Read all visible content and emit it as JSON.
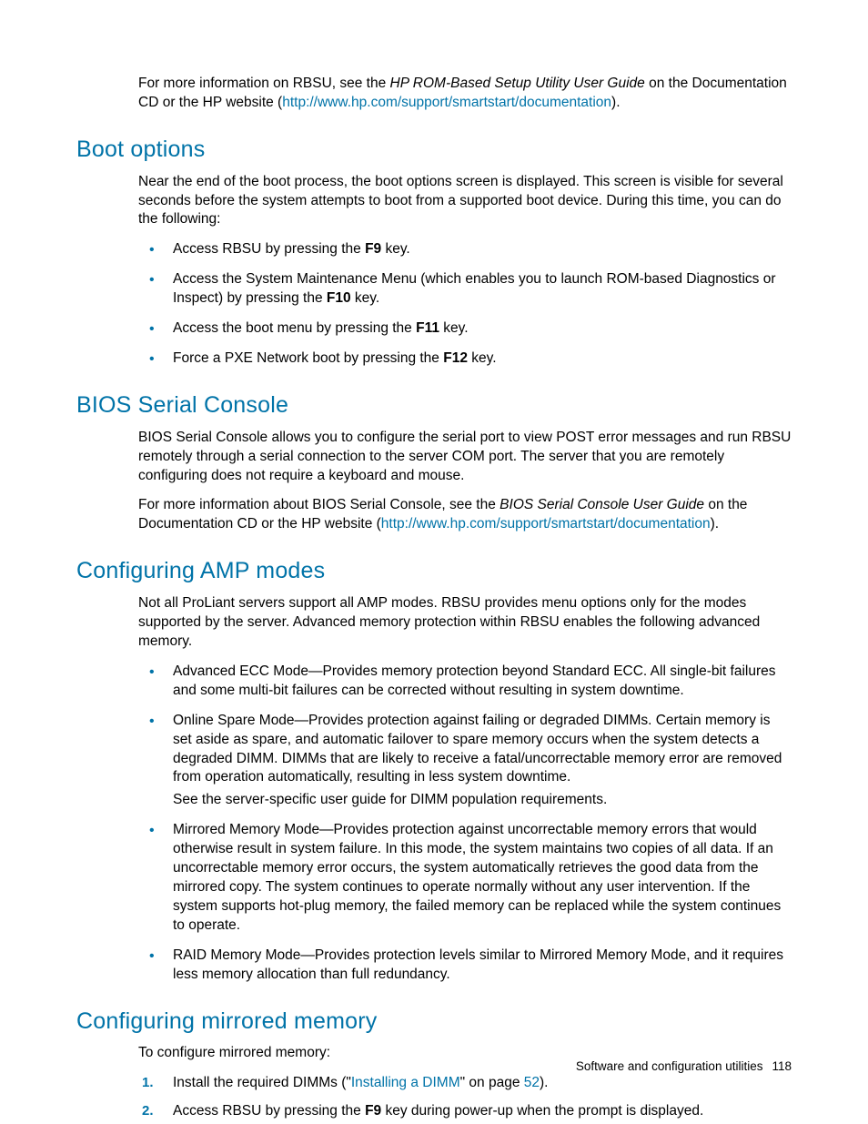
{
  "intro": {
    "pre": "For more information on RBSU, see the ",
    "em": "HP ROM-Based Setup Utility User Guide",
    "mid": " on the Documentation CD or the HP website (",
    "link": "http://www.hp.com/support/smartstart/documentation",
    "post": ")."
  },
  "boot": {
    "heading": "Boot options",
    "para": "Near the end of the boot process, the boot options screen is displayed. This screen is visible for several seconds before the system attempts to boot from a supported boot device. During this time, you can do the following:",
    "items": {
      "i1": {
        "pre": "Access RBSU by pressing the ",
        "key": "F9",
        "post": " key."
      },
      "i2": {
        "pre": "Access the System Maintenance Menu (which enables you to launch ROM-based Diagnostics or Inspect) by pressing the ",
        "key": "F10",
        "post": " key."
      },
      "i3": {
        "pre": "Access the boot menu by pressing the ",
        "key": "F11",
        "post": " key."
      },
      "i4": {
        "pre": "Force a PXE Network boot by pressing the ",
        "key": "F12",
        "post": " key."
      }
    }
  },
  "bios": {
    "heading": "BIOS Serial Console",
    "para1": "BIOS Serial Console allows you to configure the serial port to view POST error messages and run RBSU remotely through a serial connection to the server COM port. The server that you are remotely configuring does not require a keyboard and mouse.",
    "p2pre": "For more information about BIOS Serial Console, see the ",
    "p2em": "BIOS Serial Console User Guide",
    "p2mid": " on the Documentation CD or the HP website (",
    "p2link": "http://www.hp.com/support/smartstart/documentation",
    "p2post": ")."
  },
  "amp": {
    "heading": "Configuring AMP modes",
    "para": "Not all ProLiant servers support all AMP modes. RBSU provides menu options only for the modes supported by the server. Advanced memory protection within RBSU enables the following advanced memory.",
    "items": {
      "i1": "Advanced ECC Mode—Provides memory protection beyond Standard ECC. All single-bit failures and some multi-bit failures can be corrected without resulting in system downtime.",
      "i2": "Online Spare Mode—Provides protection against failing or degraded DIMMs. Certain memory is set aside as spare, and automatic failover to spare memory occurs when the system detects a degraded DIMM. DIMMs that are likely to receive a fatal/uncorrectable memory error are removed from operation automatically, resulting in less system downtime.",
      "i2b": "See the server-specific user guide for DIMM population requirements.",
      "i3": "Mirrored Memory Mode—Provides protection against uncorrectable memory errors that would otherwise result in system failure. In this mode, the system maintains two copies of all data. If an uncorrectable memory error occurs, the system automatically retrieves the good data from the mirrored copy. The system continues to operate normally without any user intervention. If the system supports hot-plug memory, the failed memory can be replaced while the system continues to operate.",
      "i4": "RAID Memory Mode—Provides protection levels similar to Mirrored Memory Mode, and it requires less memory allocation than full redundancy."
    }
  },
  "mirror": {
    "heading": "Configuring mirrored memory",
    "para": "To configure mirrored memory:",
    "s1": {
      "pre": "Install the required DIMMs (\"",
      "link": "Installing a DIMM",
      "mid": "\" on page ",
      "page": "52",
      "post": ")."
    },
    "s2": {
      "pre": "Access RBSU by pressing the ",
      "key": "F9",
      "post": " key during power-up when the prompt is displayed."
    }
  },
  "footer": {
    "section": "Software and configuration utilities",
    "page": "118"
  }
}
